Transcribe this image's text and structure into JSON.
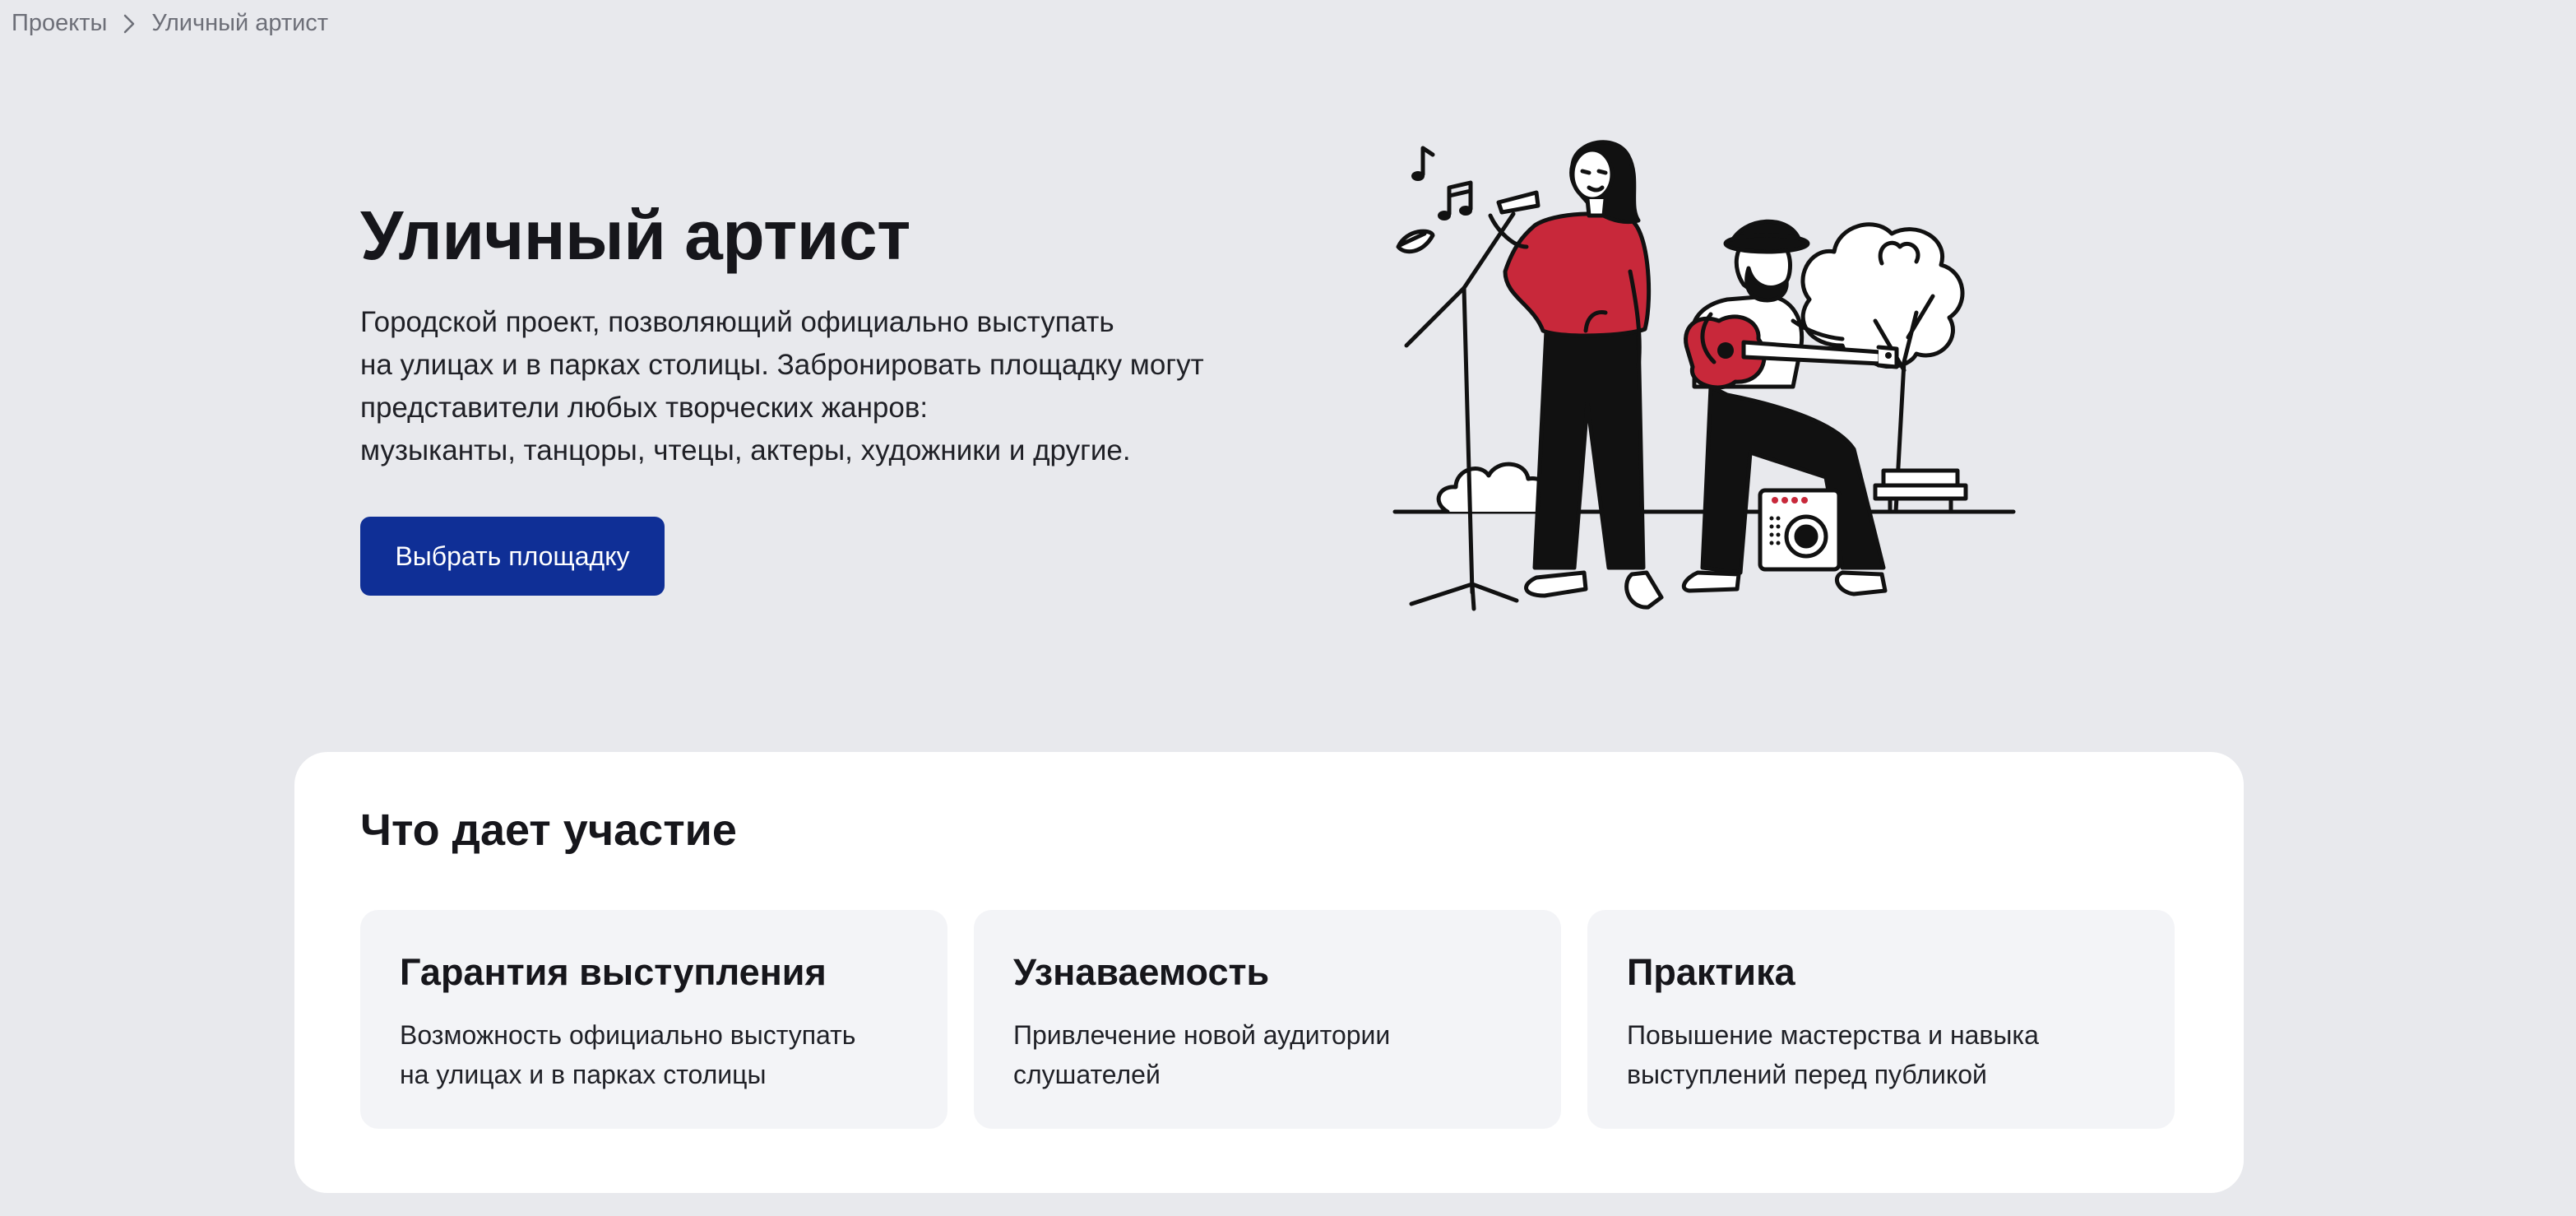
{
  "breadcrumb": {
    "parent": "Проекты",
    "current": "Уличный артист"
  },
  "hero": {
    "title": "Уличный артист",
    "description": "Городской проект, позволяющий официально выступать\nна улицах и в парках столицы. Забронировать площадку могут\nпредставители любых творческих жанров:\nмузыканты, танцоры, чтецы, актеры, художники и другие.",
    "cta_label": "Выбрать площадку",
    "illustration_icon": "street-musicians-illustration"
  },
  "colors": {
    "background": "#e8e9ed",
    "accent": "#0f2f96",
    "illustration_red": "#c8283a",
    "card": "#ffffff",
    "tile": "#f3f4f7"
  },
  "benefits": {
    "title": "Что дает участие",
    "items": [
      {
        "title": "Гарантия выступления",
        "text": "Возможность официально выступать\nна улицах и в парках столицы"
      },
      {
        "title": "Узнаваемость",
        "text": "Привлечение новой аудитории\nслушателей"
      },
      {
        "title": "Практика",
        "text": "Повышение мастерства и навыка\nвыступлений перед публикой"
      }
    ]
  }
}
